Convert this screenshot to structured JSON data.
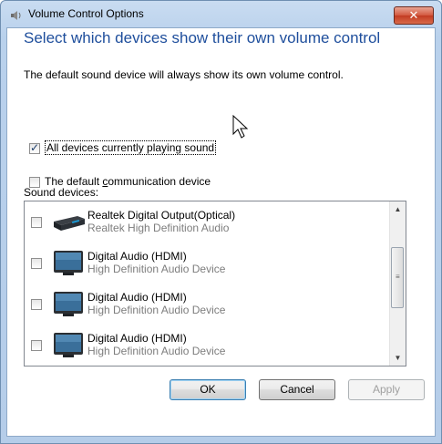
{
  "window": {
    "title": "Volume Control Options",
    "close_label": "✕"
  },
  "headline": "Select which devices show their own volume control",
  "description": "The default sound device will always show its own volume control.",
  "options": [
    {
      "label": "All devices currently playing sound",
      "checked": true
    },
    {
      "label_pre": "The default ",
      "label_accel": "c",
      "label_post": "ommunication device",
      "checked": false
    }
  ],
  "sound_devices_label": "Sound devices:",
  "devices": [
    {
      "name": "Realtek Digital Output(Optical)",
      "driver": "Realtek High Definition Audio",
      "icon": "optical-receiver-icon",
      "checked": false
    },
    {
      "name": "Digital Audio (HDMI)",
      "driver": "High Definition Audio Device",
      "icon": "monitor-icon",
      "checked": false
    },
    {
      "name": "Digital Audio (HDMI)",
      "driver": "High Definition Audio Device",
      "icon": "monitor-icon",
      "checked": false
    },
    {
      "name": "Digital Audio (HDMI)",
      "driver": "High Definition Audio Device",
      "icon": "monitor-icon",
      "checked": false
    }
  ],
  "buttons": {
    "ok": "OK",
    "cancel": "Cancel",
    "apply": "Apply"
  },
  "colors": {
    "headline": "#1e4e9c",
    "close_button": "#c23b22",
    "subtext": "#7d7d7d"
  }
}
